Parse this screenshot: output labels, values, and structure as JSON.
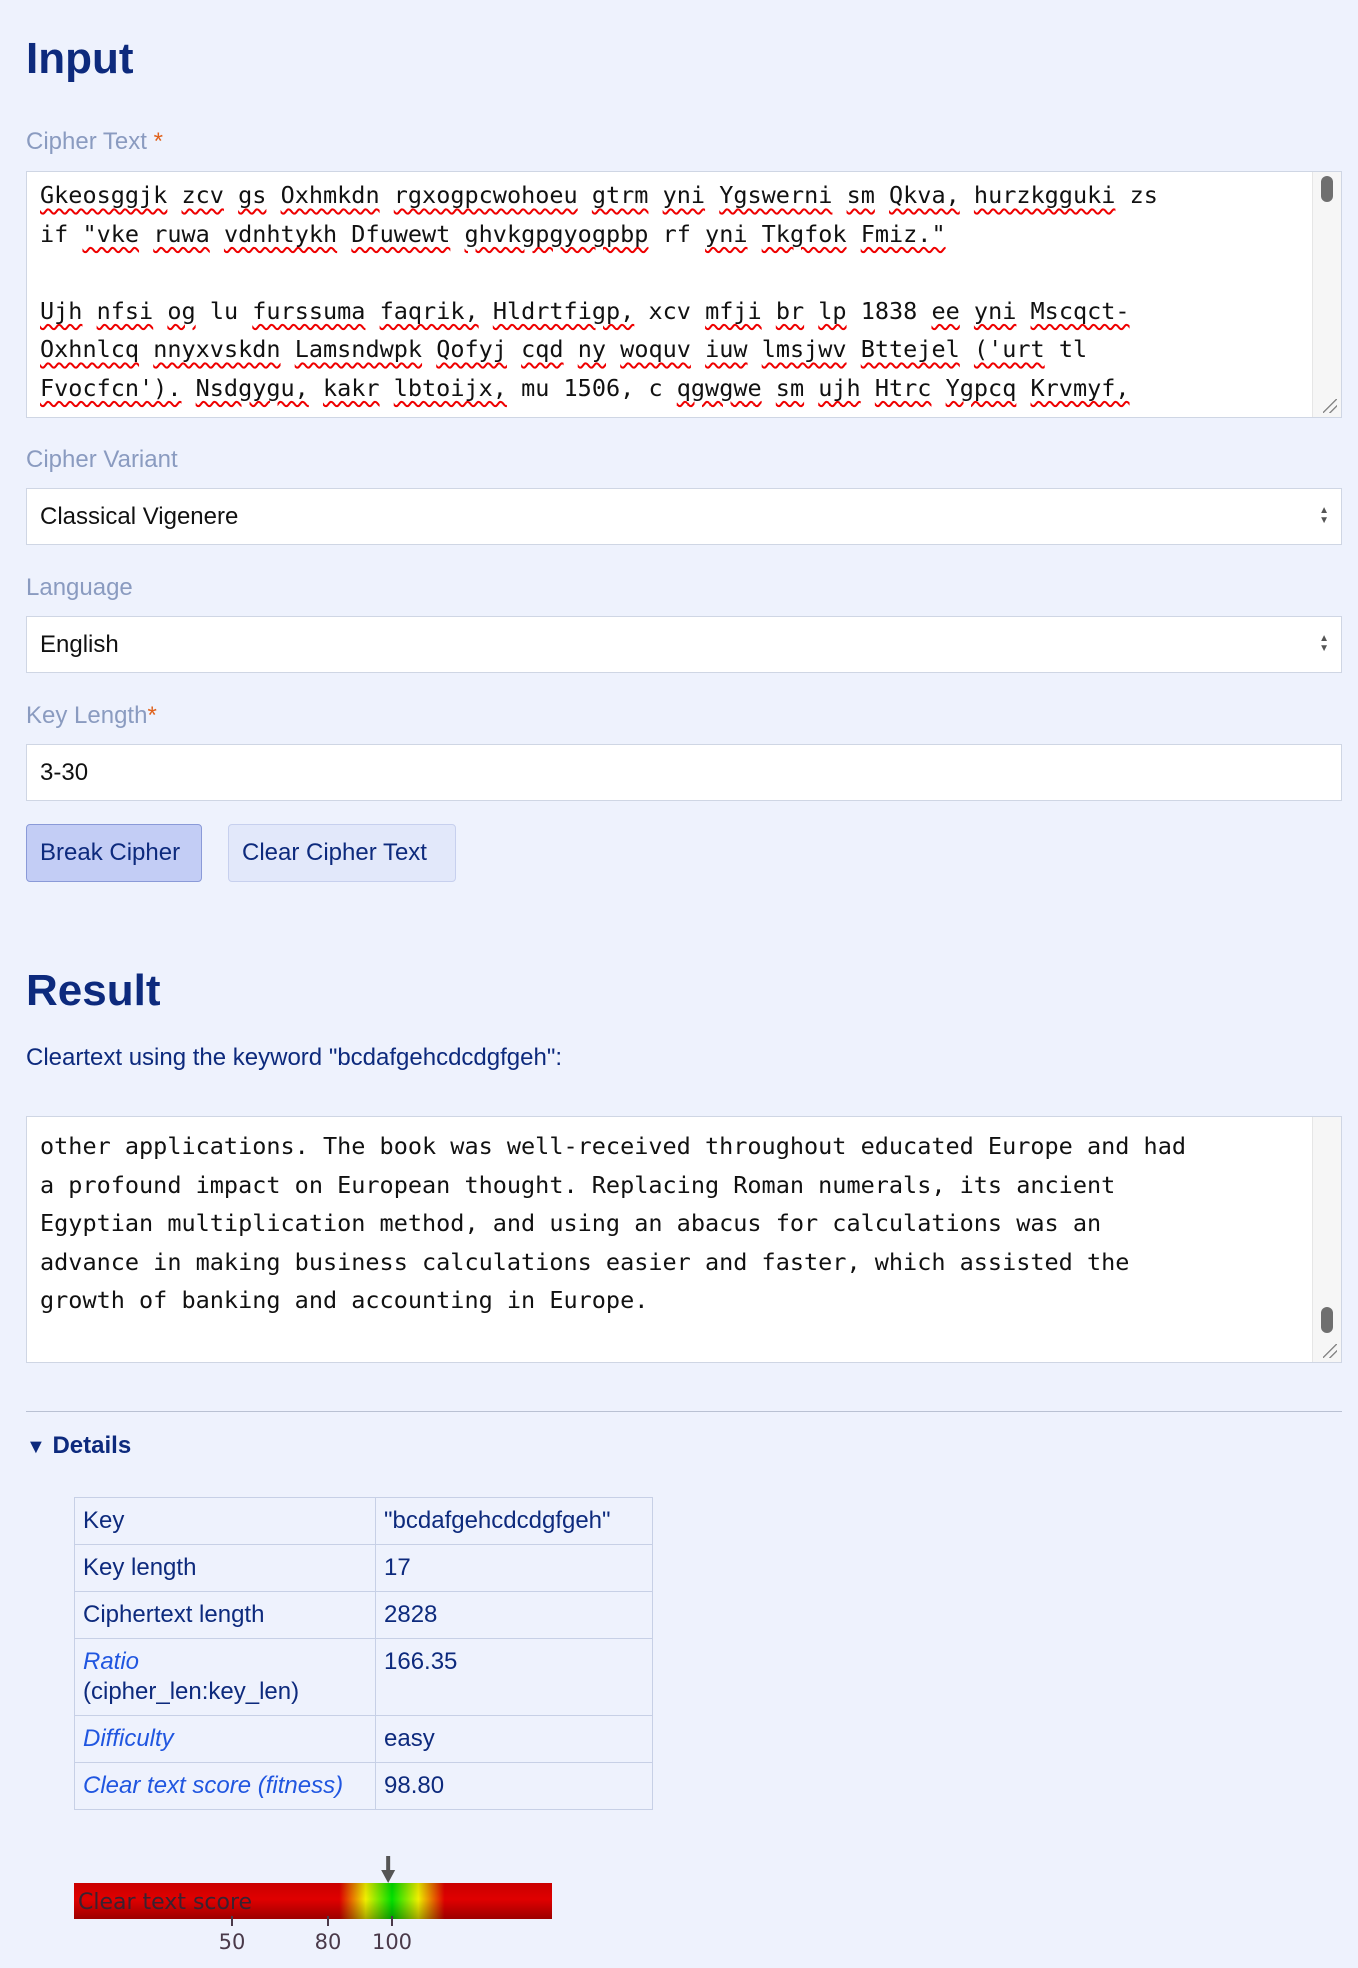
{
  "input": {
    "heading": "Input",
    "cipher_text_label": "Cipher Text",
    "required_mark": "*",
    "cipher_text_lines": [
      [
        "Gkeosggjk",
        "zcv",
        "gs",
        "Oxhmkdn",
        "rgxogpcwohoeu",
        "gtrm",
        "yni",
        "Ygswerni",
        "sm",
        "Qkva,",
        "hurzkgguki",
        "zs"
      ],
      [
        "if",
        "\"vke",
        "ruwa",
        "vdnhtykh",
        "Dfuwewt",
        "ghvkgpgyogpbp",
        "rf",
        "yni",
        "Tkgfok",
        "Fmiz.\""
      ],
      [],
      [
        "Ujh",
        "nfsi",
        "og",
        "lu",
        "furssuma",
        "faqrik,",
        "Hldrtfigp,",
        "xcv",
        "mfji",
        "br",
        "lp",
        "1838",
        "ee",
        "yni",
        "Mscqct-"
      ],
      [
        "Oxhnlcq",
        "nnyxvskdn",
        "Lamsndwpk",
        "Qofyj",
        "cqd",
        "ny",
        "woquv",
        "iuw",
        "lmsjwv",
        "Bttejel",
        "('urt",
        "tl"
      ],
      [
        "Fvocfcn').",
        "Nsdgygu,",
        "kakr",
        "lbtoijx,",
        "mu",
        "1506,",
        "c",
        "qgwgwe",
        "sm",
        "ujh",
        "Htrc",
        "Ygpcq",
        "Krvmyf,"
      ]
    ],
    "cipher_variant_label": "Cipher Variant",
    "cipher_variant_value": "Classical Vigenere",
    "language_label": "Language",
    "language_value": "English",
    "key_length_label": "Key Length",
    "key_length_value": "3-30",
    "break_button": "Break Cipher",
    "clear_button": "Clear Cipher Text"
  },
  "result": {
    "heading": "Result",
    "cleartext_label": "Cleartext using the keyword \"bcdafgehcdcdgfgeh\":",
    "cleartext_lines": [
      "other applications. The book was well-received throughout educated Europe and had",
      "a profound impact on European thought. Replacing Roman numerals, its ancient",
      "Egyptian multiplication method, and using an abacus for calculations was an",
      "advance in making business calculations easier and faster, which assisted the",
      "growth of banking and accounting in Europe."
    ]
  },
  "details": {
    "summary": "Details",
    "rows": [
      {
        "key": "Key",
        "value": "\"bcdafgehcdcdgfgeh\"",
        "link": false
      },
      {
        "key": "Key length",
        "value": "17",
        "link": false
      },
      {
        "key": "Ciphertext length",
        "value": "2828",
        "link": false
      },
      {
        "key": "Ratio",
        "key_sub": "(cipher_len:key_len)",
        "value": "166.35",
        "link": true
      },
      {
        "key": "Difficulty",
        "value": "easy",
        "link": true
      },
      {
        "key": "Clear text score (fitness)",
        "value": "98.80",
        "link": true
      }
    ]
  },
  "score_bar": {
    "label": "Clear text score",
    "value": 98.8,
    "ticks": [
      50,
      80,
      100
    ],
    "colors": {
      "bad": "#e00000",
      "good": "#00e000",
      "mid": "#f0f000"
    }
  }
}
